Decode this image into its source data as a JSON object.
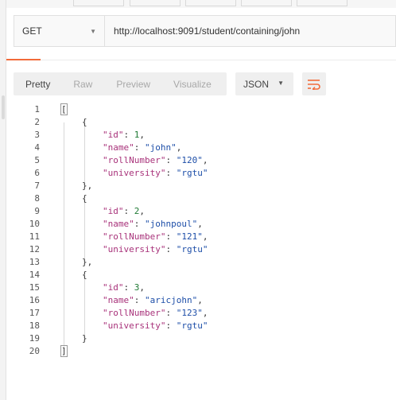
{
  "request": {
    "method": "GET",
    "url": "http://localhost:9091/student/containing/john"
  },
  "response": {
    "view_tabs": [
      "Pretty",
      "Raw",
      "Preview",
      "Visualize"
    ],
    "active_view": "Pretty",
    "format": "JSON"
  },
  "body_lines": [
    {
      "n": "1",
      "indent": 0,
      "tokens": [
        {
          "t": "[",
          "c": "punct"
        }
      ]
    },
    {
      "n": "2",
      "indent": 1,
      "tokens": [
        {
          "t": "{",
          "c": "punct"
        }
      ]
    },
    {
      "n": "3",
      "indent": 2,
      "tokens": [
        {
          "t": "\"id\"",
          "c": "key"
        },
        {
          "t": ": ",
          "c": "punct"
        },
        {
          "t": "1",
          "c": "num"
        },
        {
          "t": ",",
          "c": "punct"
        }
      ]
    },
    {
      "n": "4",
      "indent": 2,
      "tokens": [
        {
          "t": "\"name\"",
          "c": "key"
        },
        {
          "t": ": ",
          "c": "punct"
        },
        {
          "t": "\"john\"",
          "c": "str"
        },
        {
          "t": ",",
          "c": "punct"
        }
      ]
    },
    {
      "n": "5",
      "indent": 2,
      "tokens": [
        {
          "t": "\"rollNumber\"",
          "c": "key"
        },
        {
          "t": ": ",
          "c": "punct"
        },
        {
          "t": "\"120\"",
          "c": "str"
        },
        {
          "t": ",",
          "c": "punct"
        }
      ]
    },
    {
      "n": "6",
      "indent": 2,
      "tokens": [
        {
          "t": "\"university\"",
          "c": "key"
        },
        {
          "t": ": ",
          "c": "punct"
        },
        {
          "t": "\"rgtu\"",
          "c": "str"
        }
      ]
    },
    {
      "n": "7",
      "indent": 1,
      "tokens": [
        {
          "t": "},",
          "c": "punct"
        }
      ]
    },
    {
      "n": "8",
      "indent": 1,
      "tokens": [
        {
          "t": "{",
          "c": "punct"
        }
      ]
    },
    {
      "n": "9",
      "indent": 2,
      "tokens": [
        {
          "t": "\"id\"",
          "c": "key"
        },
        {
          "t": ": ",
          "c": "punct"
        },
        {
          "t": "2",
          "c": "num"
        },
        {
          "t": ",",
          "c": "punct"
        }
      ]
    },
    {
      "n": "10",
      "indent": 2,
      "tokens": [
        {
          "t": "\"name\"",
          "c": "key"
        },
        {
          "t": ": ",
          "c": "punct"
        },
        {
          "t": "\"johnpoul\"",
          "c": "str"
        },
        {
          "t": ",",
          "c": "punct"
        }
      ]
    },
    {
      "n": "11",
      "indent": 2,
      "tokens": [
        {
          "t": "\"rollNumber\"",
          "c": "key"
        },
        {
          "t": ": ",
          "c": "punct"
        },
        {
          "t": "\"121\"",
          "c": "str"
        },
        {
          "t": ",",
          "c": "punct"
        }
      ]
    },
    {
      "n": "12",
      "indent": 2,
      "tokens": [
        {
          "t": "\"university\"",
          "c": "key"
        },
        {
          "t": ": ",
          "c": "punct"
        },
        {
          "t": "\"rgtu\"",
          "c": "str"
        }
      ]
    },
    {
      "n": "13",
      "indent": 1,
      "tokens": [
        {
          "t": "},",
          "c": "punct"
        }
      ]
    },
    {
      "n": "14",
      "indent": 1,
      "tokens": [
        {
          "t": "{",
          "c": "punct"
        }
      ]
    },
    {
      "n": "15",
      "indent": 2,
      "tokens": [
        {
          "t": "\"id\"",
          "c": "key"
        },
        {
          "t": ": ",
          "c": "punct"
        },
        {
          "t": "3",
          "c": "num"
        },
        {
          "t": ",",
          "c": "punct"
        }
      ]
    },
    {
      "n": "16",
      "indent": 2,
      "tokens": [
        {
          "t": "\"name\"",
          "c": "key"
        },
        {
          "t": ": ",
          "c": "punct"
        },
        {
          "t": "\"aricjohn\"",
          "c": "str"
        },
        {
          "t": ",",
          "c": "punct"
        }
      ]
    },
    {
      "n": "17",
      "indent": 2,
      "tokens": [
        {
          "t": "\"rollNumber\"",
          "c": "key"
        },
        {
          "t": ": ",
          "c": "punct"
        },
        {
          "t": "\"123\"",
          "c": "str"
        },
        {
          "t": ",",
          "c": "punct"
        }
      ]
    },
    {
      "n": "18",
      "indent": 2,
      "tokens": [
        {
          "t": "\"university\"",
          "c": "key"
        },
        {
          "t": ": ",
          "c": "punct"
        },
        {
          "t": "\"rgtu\"",
          "c": "str"
        }
      ]
    },
    {
      "n": "19",
      "indent": 1,
      "tokens": [
        {
          "t": "}",
          "c": "punct"
        }
      ]
    },
    {
      "n": "20",
      "indent": 0,
      "tokens": [
        {
          "t": "]",
          "c": "punct"
        }
      ]
    }
  ],
  "colors": {
    "accent": "#f26b3a",
    "json_key": "#a8327a",
    "json_number": "#1f7a34",
    "json_string": "#1d4ea8"
  },
  "icons": {
    "method_dropdown": "chevron-down-icon",
    "format_dropdown": "chevron-down-icon",
    "wrap": "wrap-lines-icon"
  }
}
